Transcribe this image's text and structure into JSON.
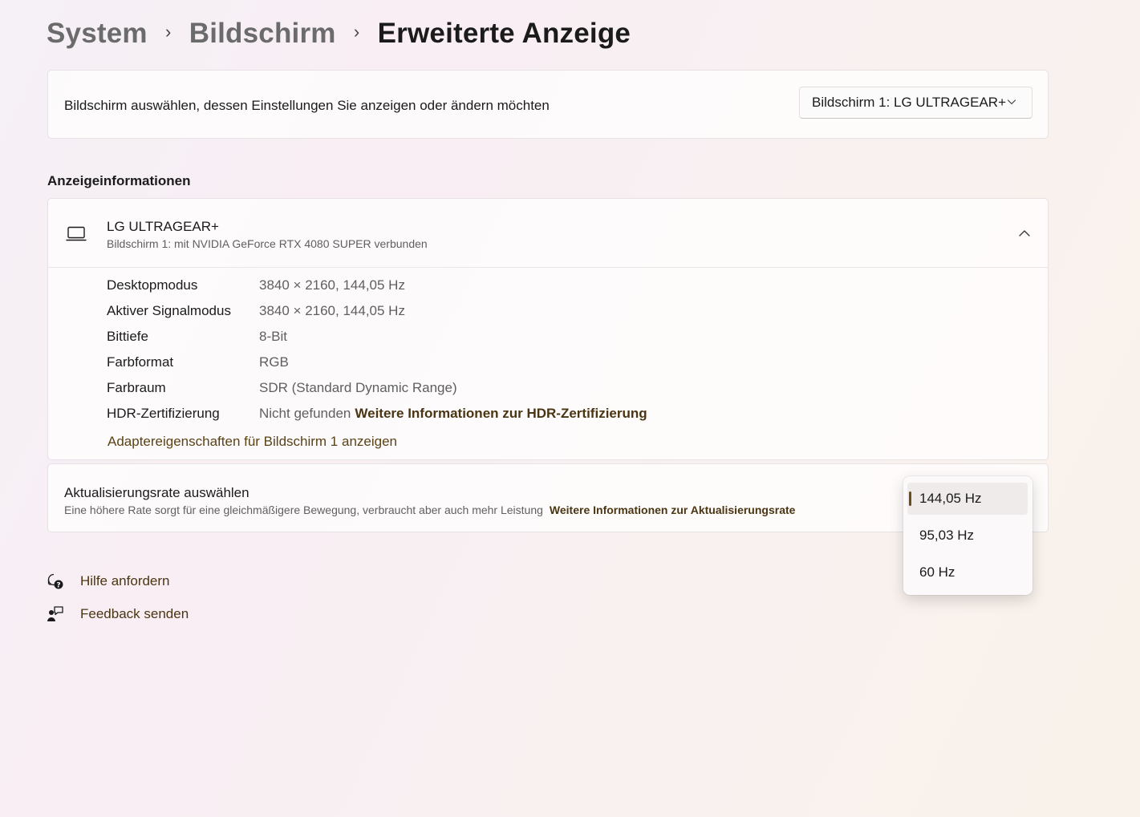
{
  "breadcrumb": {
    "items": [
      "System",
      "Bildschirm",
      "Erweiterte Anzeige"
    ],
    "separator": "›"
  },
  "monitor_select": {
    "label": "Bildschirm auswählen, dessen Einstellungen Sie anzeigen oder ändern möchten",
    "selected": "Bildschirm 1: LG ULTRAGEAR+",
    "icon": "chevron-down-icon"
  },
  "display_info": {
    "section_title": "Anzeigeinformationen",
    "monitor_name": "LG ULTRAGEAR+",
    "monitor_sub": "Bildschirm 1: mit NVIDIA GeForce RTX 4080 SUPER verbunden",
    "icon": "laptop-icon",
    "expanded": true,
    "rows": [
      {
        "key": "Desktopmodus",
        "value": "3840 × 2160, 144,05 Hz"
      },
      {
        "key": "Aktiver Signalmodus",
        "value": "3840 × 2160, 144,05 Hz"
      },
      {
        "key": "Bittiefe",
        "value": "8-Bit"
      },
      {
        "key": "Farbformat",
        "value": "RGB"
      },
      {
        "key": "Farbraum",
        "value": "SDR (Standard Dynamic Range)"
      },
      {
        "key": "HDR-Zertifizierung",
        "value": "Nicht gefunden",
        "link": "Weitere Informationen zur HDR-Zertifizierung"
      }
    ],
    "adapter_link": "Adaptereigenschaften für Bildschirm 1 anzeigen"
  },
  "refresh_rate": {
    "title": "Aktualisierungsrate auswählen",
    "description": "Eine höhere Rate sorgt für eine gleichmäßigere Bewegung, verbraucht aber auch mehr Leistung",
    "link": "Weitere Informationen zur Aktualisierungsrate",
    "options": [
      "144,05 Hz",
      "95,03 Hz",
      "60 Hz"
    ],
    "selected": "144,05 Hz"
  },
  "help": {
    "get_help": "Hilfe anfordern",
    "feedback": "Feedback senden"
  },
  "colors": {
    "accent": "#6b4d1c",
    "link": "#4a3512"
  }
}
